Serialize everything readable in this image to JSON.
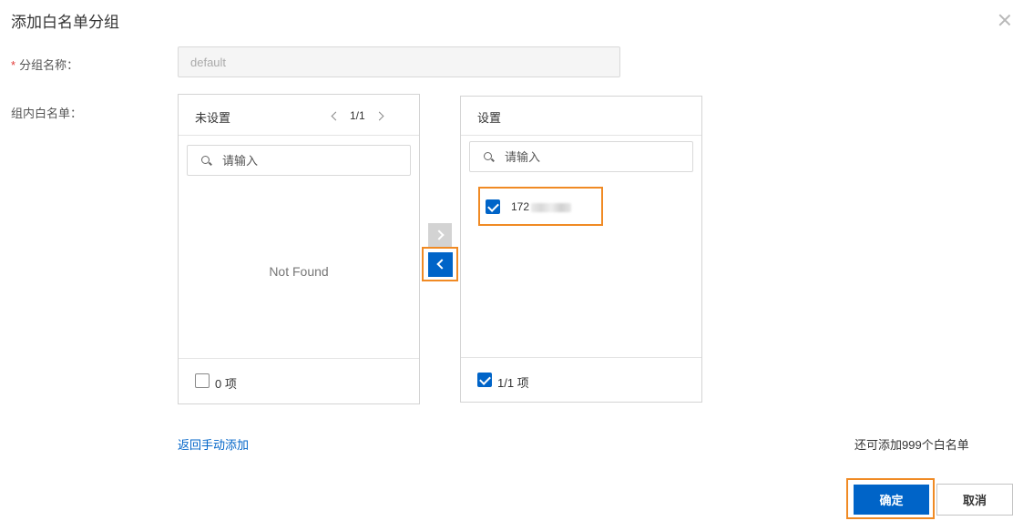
{
  "dialog": {
    "title": "添加白名单分组",
    "close_icon": "close-icon"
  },
  "form": {
    "group_name": {
      "required_mark": "*",
      "label": "分组名称：",
      "value": "default"
    },
    "whitelist": {
      "label": "组内白名单："
    }
  },
  "transfer": {
    "left": {
      "title": "未设置",
      "pagination": "1/1",
      "search_placeholder": "请输入",
      "empty_text": "Not Found",
      "footer_count": "0 项",
      "footer_checked": false
    },
    "right": {
      "title": "设置",
      "search_placeholder": "请输入",
      "items": [
        {
          "text": "172",
          "checked": true
        }
      ],
      "footer_count": "1/1 项",
      "footer_checked": true
    },
    "move_right_enabled": false,
    "move_left_enabled": true
  },
  "links": {
    "back_manual": "返回手动添加"
  },
  "remaining_text": "还可添加999个白名单",
  "buttons": {
    "ok": "确定",
    "cancel": "取消"
  },
  "colors": {
    "primary": "#0064c8",
    "highlight": "#f08a24",
    "required": "#e23c39"
  }
}
